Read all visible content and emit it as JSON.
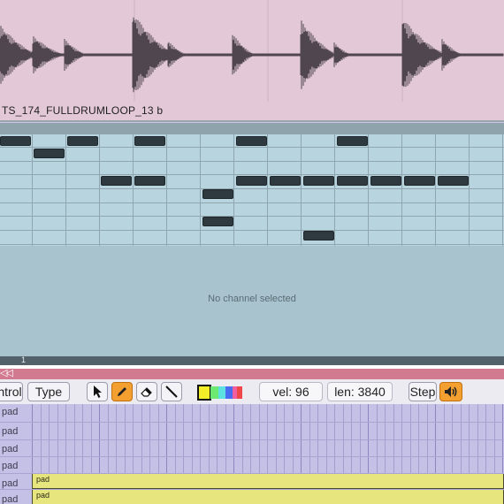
{
  "clip": {
    "name": "TS_174_FULLDRUMLOOP_13 b"
  },
  "piano_roll": {
    "empty_message": "No channel selected",
    "bar_number": "1"
  },
  "toolbar": {
    "control_label": "ntrol",
    "type_label": "Type",
    "velocity": "vel: 96",
    "length": "len: 3840",
    "step_label": "Step"
  },
  "lanes": {
    "labels": [
      "pad",
      "pad",
      "pad",
      "pad",
      "pad",
      "pad"
    ],
    "clip_labels": [
      "pad",
      "pad"
    ]
  },
  "colors": {
    "accent": "#f3a030",
    "clip_fill": "#e7e57e",
    "note_fill": "#2e3a40",
    "color_swatches": [
      "#f4ee2a",
      "#6de870",
      "#5ce0e0",
      "#4a6cf0",
      "#f060a0",
      "#f04848"
    ]
  },
  "icons": {
    "back": "double-left-arrow-icon",
    "select": "pointer-arrow-icon",
    "draw": "pencil-icon",
    "erase": "eraser-icon",
    "line": "line-tool-icon",
    "sound": "speaker-icon"
  }
}
